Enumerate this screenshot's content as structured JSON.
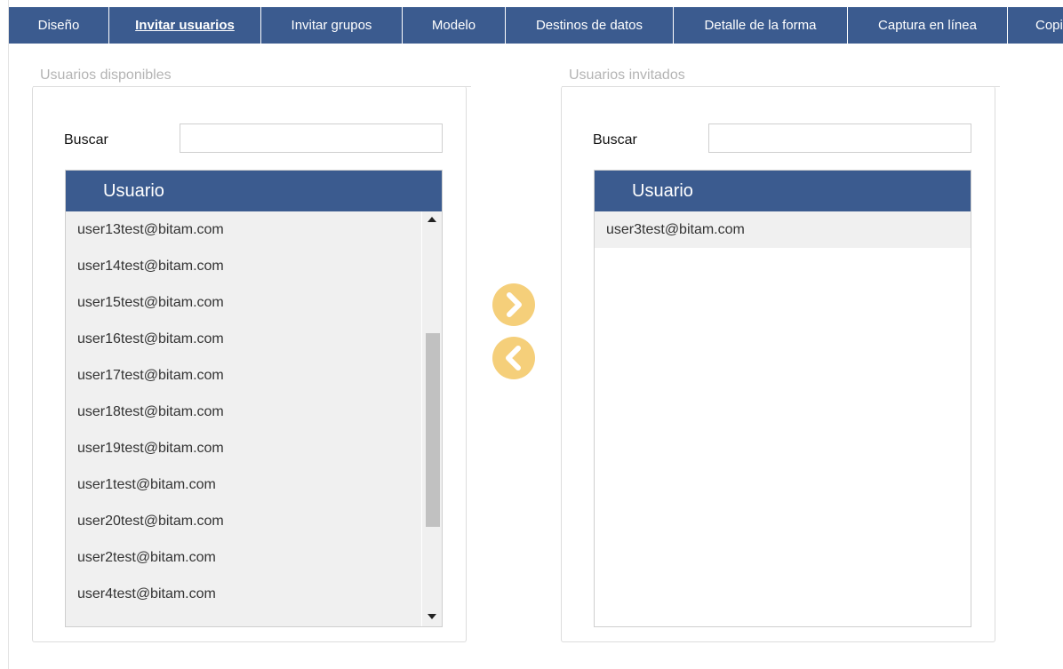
{
  "tabs": [
    {
      "label": "Diseño"
    },
    {
      "label": "Invitar usuarios"
    },
    {
      "label": "Invitar grupos"
    },
    {
      "label": "Modelo"
    },
    {
      "label": "Destinos de datos"
    },
    {
      "label": "Detalle de la forma"
    },
    {
      "label": "Captura en línea"
    },
    {
      "label": "Copi"
    }
  ],
  "active_tab": "Invitar usuarios",
  "available": {
    "legend": "Usuarios disponibles",
    "search_label": "Buscar",
    "search_value": "",
    "column_header": "Usuario",
    "rows": [
      "user13test@bitam.com",
      "user14test@bitam.com",
      "user15test@bitam.com",
      "user16test@bitam.com",
      "user17test@bitam.com",
      "user18test@bitam.com",
      "user19test@bitam.com",
      "user1test@bitam.com",
      "user20test@bitam.com",
      "user2test@bitam.com",
      "user4test@bitam.com"
    ]
  },
  "invited": {
    "legend": "Usuarios invitados",
    "search_label": "Buscar",
    "search_value": "",
    "column_header": "Usuario",
    "rows": [
      "user3test@bitam.com"
    ]
  },
  "icons": {
    "add": "chevron-right-icon",
    "remove": "chevron-left-icon"
  },
  "colors": {
    "header_blue": "#3b5b8f",
    "arrow_yellow": "#f5cf7a",
    "row_bg": "#f0f0f0",
    "legend_gray": "#b4b4b4"
  }
}
